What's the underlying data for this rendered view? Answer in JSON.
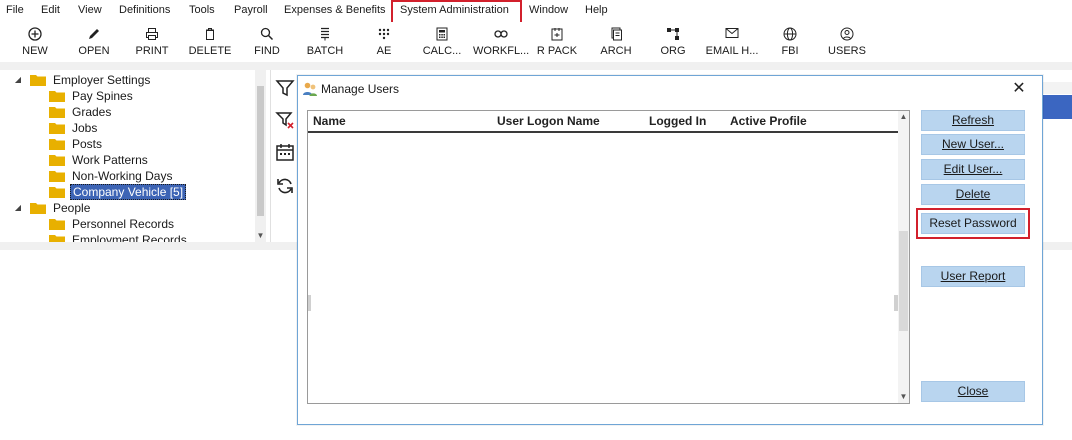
{
  "menubar": {
    "items": [
      "File",
      "Edit",
      "View",
      "Definitions",
      "Tools",
      "Payroll",
      "Expenses & Benefits",
      "System Administration",
      "Window",
      "Help"
    ],
    "highlighted": "System Administration"
  },
  "toolbar": {
    "items": [
      {
        "label": "NEW",
        "icon": "plus-circle-icon"
      },
      {
        "label": "OPEN",
        "icon": "pencil-icon"
      },
      {
        "label": "PRINT",
        "icon": "printer-icon"
      },
      {
        "label": "DELETE",
        "icon": "trash-icon"
      },
      {
        "label": "FIND",
        "icon": "magnifier-icon"
      },
      {
        "label": "BATCH",
        "icon": "batch-icon"
      },
      {
        "label": "AE",
        "icon": "ae-icon"
      },
      {
        "label": "CALC...",
        "icon": "calculator-icon"
      },
      {
        "label": "WORKFL...",
        "icon": "workflow-icon"
      },
      {
        "label": "R PACK",
        "icon": "pack-icon"
      },
      {
        "label": "ARCH",
        "icon": "archive-icon"
      },
      {
        "label": "ORG",
        "icon": "org-chart-icon"
      },
      {
        "label": "EMAIL H...",
        "icon": "envelope-icon"
      },
      {
        "label": "FBI",
        "icon": "globe-icon"
      },
      {
        "label": "USERS",
        "icon": "user-icon"
      }
    ]
  },
  "tree": {
    "items": [
      {
        "label": "Employer Settings",
        "level": 0,
        "expanded": true
      },
      {
        "label": "Pay Spines",
        "level": 1
      },
      {
        "label": "Grades",
        "level": 1
      },
      {
        "label": "Jobs",
        "level": 1
      },
      {
        "label": "Posts",
        "level": 1
      },
      {
        "label": "Work Patterns",
        "level": 1
      },
      {
        "label": "Non-Working Days",
        "level": 1
      },
      {
        "label": "Company Vehicle [5]",
        "level": 1,
        "selected": true
      },
      {
        "label": "People",
        "level": 0,
        "expanded": true
      },
      {
        "label": "Personnel Records",
        "level": 1
      },
      {
        "label": "Employment Records",
        "level": 1
      }
    ]
  },
  "side_icons": [
    "filter-icon",
    "filter-clear-icon",
    "calendar-icon",
    "refresh-icon"
  ],
  "dialog": {
    "title": "Manage Users",
    "columns": [
      "Name",
      "User Logon Name",
      "Logged In",
      "Active Profile"
    ],
    "rows": [],
    "buttons": {
      "refresh": "Refresh",
      "new_user": "New User...",
      "edit_user": "Edit User...",
      "delete": "Delete",
      "reset_password": "Reset Password",
      "user_report": "User Report",
      "close": "Close"
    }
  },
  "colors": {
    "highlight_border": "#d2202c",
    "button_bg": "#b9d5ef",
    "selection_bg": "#3d64b5",
    "folder": "#e8b000"
  }
}
